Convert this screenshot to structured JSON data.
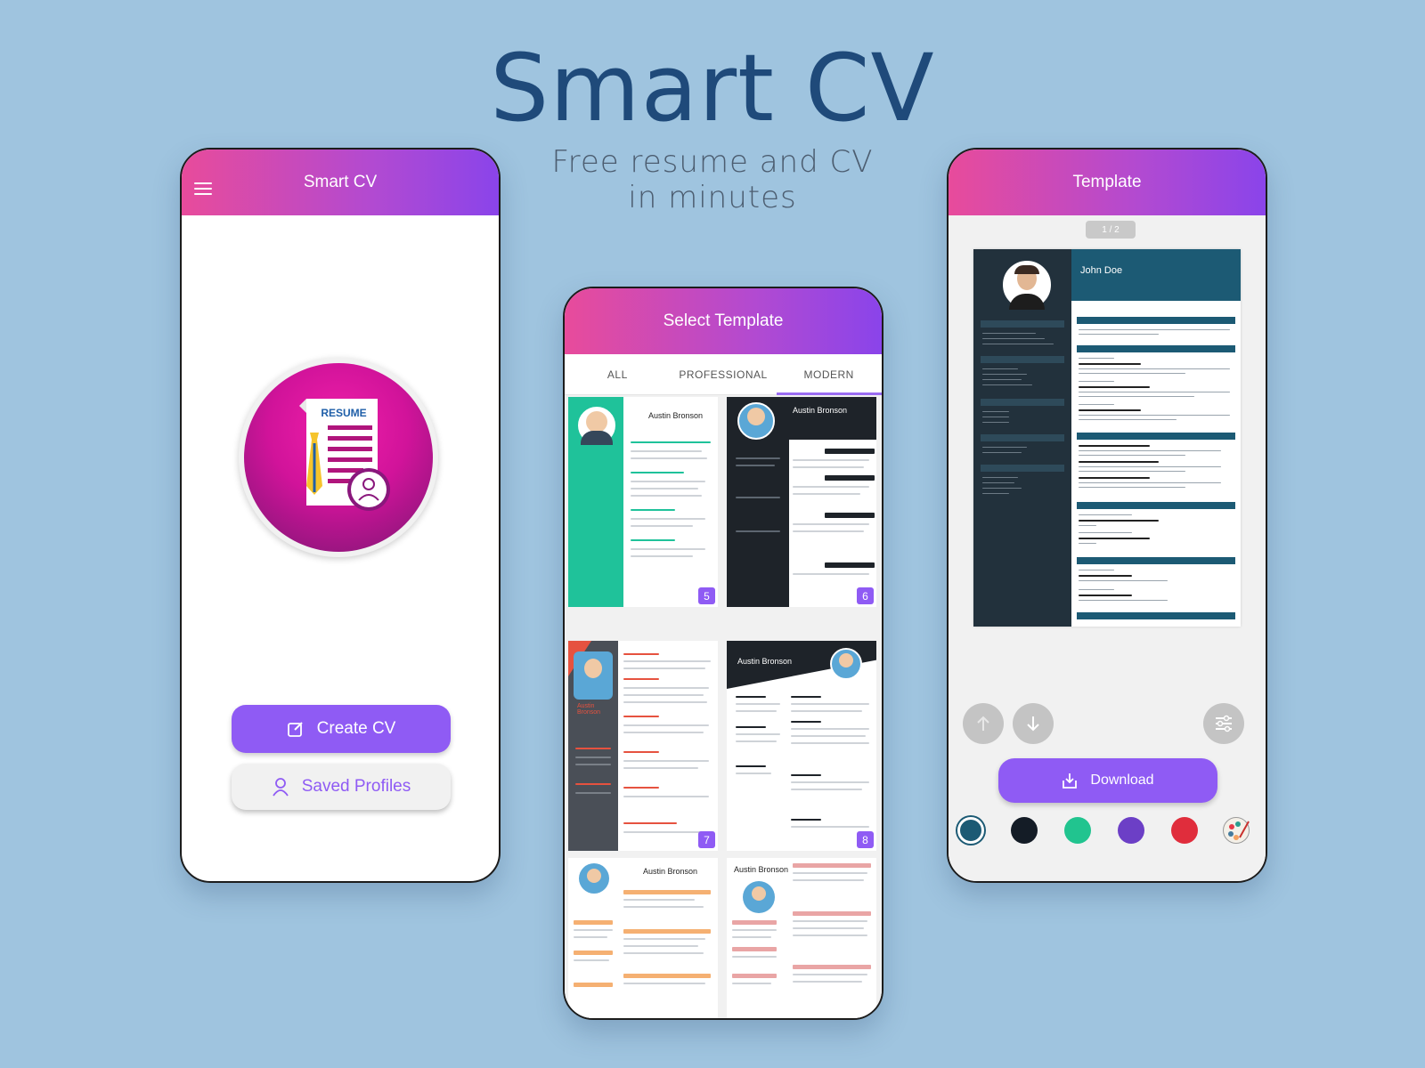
{
  "hero": {
    "title": "Smart CV",
    "subtitle_line1": "Free resume and CV",
    "subtitle_line2": "in  minutes"
  },
  "home_screen": {
    "app_title": "Smart CV",
    "logo_text": "RESUME",
    "create_button": "Create CV",
    "saved_button": "Saved Profiles"
  },
  "select_screen": {
    "title": "Select Template",
    "tabs": [
      {
        "label": "ALL",
        "active": false
      },
      {
        "label": "PROFESSIONAL",
        "active": false
      },
      {
        "label": "MODERN",
        "active": true
      }
    ],
    "templates": [
      {
        "number": "5",
        "name": "Austin Bronson",
        "accent": "#1fc29a"
      },
      {
        "number": "6",
        "name": "Austin Bronson",
        "accent": "#1e2329"
      },
      {
        "number": "7",
        "name": "Austin Bronson",
        "accent": "#e6523f"
      },
      {
        "number": "8",
        "name": "Austin Bronson",
        "accent": "#1e2329"
      },
      {
        "number": "",
        "name": "Austin Bronson",
        "accent": "#f5b072"
      },
      {
        "number": "",
        "name": "Austin Bronson",
        "accent": "#e9a5a5"
      }
    ]
  },
  "template_screen": {
    "title": "Template",
    "page_indicator": "1 / 2",
    "preview_name": "John Doe",
    "download_button": "Download",
    "colors": [
      "#1c5a74",
      "#141c26",
      "#21c48f",
      "#6c3fc6",
      "#e02d3c"
    ]
  }
}
